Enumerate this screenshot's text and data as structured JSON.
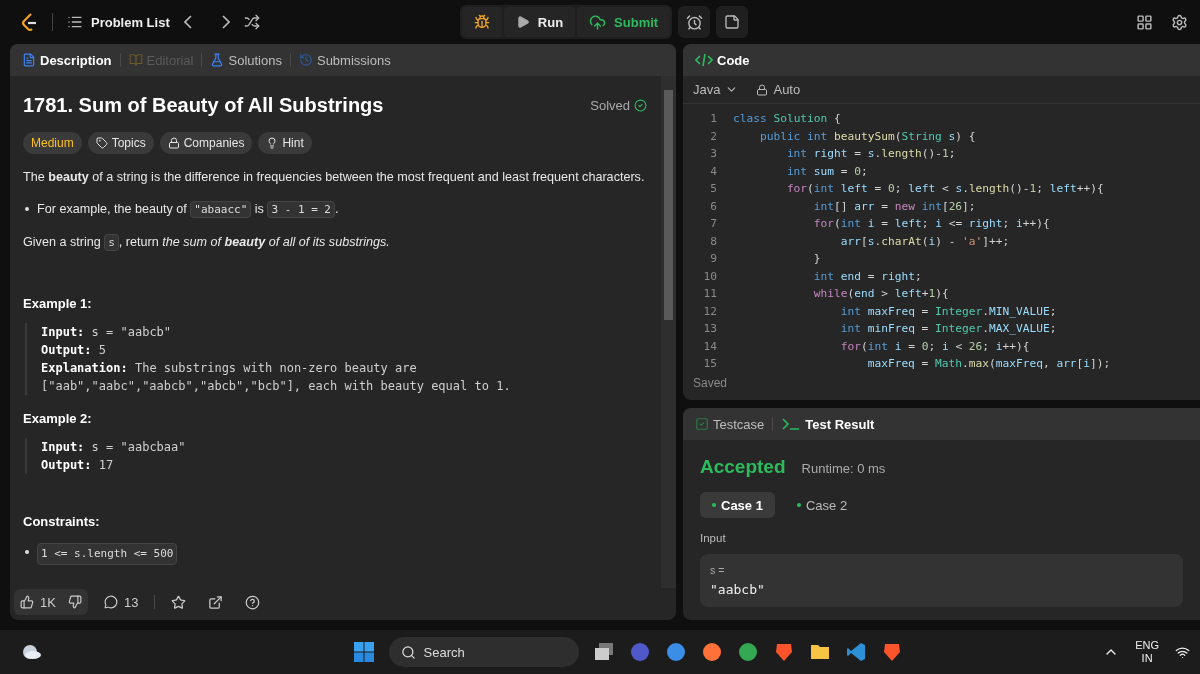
{
  "top_bar": {
    "problem_list": "Problem List",
    "run": "Run",
    "submit": "Submit"
  },
  "description_panel": {
    "tabs": [
      {
        "label": "Description",
        "selected": true,
        "disabled": false
      },
      {
        "label": "Editorial",
        "selected": false,
        "disabled": true
      },
      {
        "label": "Solutions",
        "selected": false,
        "disabled": false
      },
      {
        "label": "Submissions",
        "selected": false,
        "disabled": false
      }
    ],
    "title": "1781. Sum of Beauty of All Substrings",
    "status": "Solved",
    "tags": [
      {
        "label": "Medium",
        "kind": "difficulty"
      },
      {
        "label": "Topics",
        "kind": "topics"
      },
      {
        "label": "Companies",
        "kind": "companies"
      },
      {
        "label": "Hint",
        "kind": "hint"
      }
    ],
    "paragraphs": [
      {
        "kind": "para",
        "parts": [
          {
            "kind": "text",
            "t": "The **beauty** of a string is the difference in frequencies between the most frequent and least frequent characters."
          }
        ]
      },
      {
        "kind": "bullet",
        "parts": [
          {
            "kind": "text",
            "t": "For example, the beauty of "
          },
          {
            "kind": "code",
            "t": "\"abaacc\""
          },
          {
            "kind": "text",
            "t": " is "
          },
          {
            "kind": "code",
            "t": "3 - 1 = 2"
          },
          {
            "kind": "text",
            "t": "."
          }
        ]
      },
      {
        "kind": "para",
        "parts": [
          {
            "kind": "text",
            "t": "Given a string "
          },
          {
            "kind": "code",
            "t": "s"
          },
          {
            "kind": "text",
            "t": ", return "
          },
          {
            "kind": "em",
            "t": "the sum of **beauty** of all of its substrings."
          }
        ]
      }
    ],
    "examples": [
      {
        "heading": "Example 1:",
        "lines": [
          {
            "label": "Input:",
            "value": "s = \"aabcb\""
          },
          {
            "label": "Output:",
            "value": "5"
          },
          {
            "label": "Explanation:",
            "value": "The substrings with non-zero beauty are [\"aab\",\"aabc\",\"aabcb\",\"abcb\",\"bcb\"], each with beauty equal to 1."
          }
        ]
      },
      {
        "heading": "Example 2:",
        "lines": [
          {
            "label": "Input:",
            "value": "s = \"aabcbaa\""
          },
          {
            "label": "Output:",
            "value": "17"
          }
        ]
      }
    ],
    "constraints": {
      "heading": "Constraints:",
      "items": [
        "1 <= s.length <= 500"
      ]
    },
    "footer": {
      "likes": "1K",
      "comments": "13"
    }
  },
  "code_panel": {
    "title": "Code",
    "language": "Java",
    "mode": "Auto",
    "status": "Saved",
    "lines": [
      {
        "number": "1",
        "tokens": [
          {
            "kind": "keyword",
            "t": "class"
          },
          {
            "kind": "type",
            "t": " Solution"
          },
          {
            "kind": "plain",
            "t": " {"
          }
        ]
      },
      {
        "number": "2",
        "tokens": [
          {
            "kind": "keyword",
            "t": "    public"
          },
          {
            "kind": "keyword",
            "t": " int"
          },
          {
            "kind": "function",
            "t": " beautySum"
          },
          {
            "kind": "plain",
            "t": "("
          },
          {
            "kind": "type",
            "t": "String"
          },
          {
            "kind": "variable",
            "t": " s"
          },
          {
            "kind": "plain",
            "t": ") {"
          }
        ]
      },
      {
        "number": "3",
        "tokens": [
          {
            "kind": "keyword",
            "t": "        int"
          },
          {
            "kind": "variable",
            "t": " right"
          },
          {
            "kind": "plain",
            "t": " = "
          },
          {
            "kind": "variable",
            "t": "s"
          },
          {
            "kind": "plain",
            "t": "."
          },
          {
            "kind": "function",
            "t": "length"
          },
          {
            "kind": "plain",
            "t": "()-"
          },
          {
            "kind": "number",
            "t": "1"
          },
          {
            "kind": "plain",
            "t": ";"
          }
        ]
      },
      {
        "number": "4",
        "tokens": [
          {
            "kind": "keyword",
            "t": "        int"
          },
          {
            "kind": "variable",
            "t": " sum"
          },
          {
            "kind": "plain",
            "t": " = "
          },
          {
            "kind": "number",
            "t": "0"
          },
          {
            "kind": "plain",
            "t": ";"
          }
        ]
      },
      {
        "number": "5",
        "tokens": [
          {
            "kind": "control",
            "t": "        for"
          },
          {
            "kind": "plain",
            "t": "("
          },
          {
            "kind": "keyword",
            "t": "int"
          },
          {
            "kind": "variable",
            "t": " left"
          },
          {
            "kind": "plain",
            "t": " = "
          },
          {
            "kind": "number",
            "t": "0"
          },
          {
            "kind": "plain",
            "t": "; "
          },
          {
            "kind": "variable",
            "t": "left"
          },
          {
            "kind": "plain",
            "t": " < "
          },
          {
            "kind": "variable",
            "t": "s"
          },
          {
            "kind": "plain",
            "t": "."
          },
          {
            "kind": "function",
            "t": "length"
          },
          {
            "kind": "plain",
            "t": "()-"
          },
          {
            "kind": "number",
            "t": "1"
          },
          {
            "kind": "plain",
            "t": "; "
          },
          {
            "kind": "variable",
            "t": "left"
          },
          {
            "kind": "plain",
            "t": "++){"
          }
        ]
      },
      {
        "number": "6",
        "tokens": [
          {
            "kind": "keyword",
            "t": "            int"
          },
          {
            "kind": "plain",
            "t": "[] "
          },
          {
            "kind": "variable",
            "t": "arr"
          },
          {
            "kind": "plain",
            "t": " = "
          },
          {
            "kind": "control",
            "t": "new"
          },
          {
            "kind": "keyword",
            "t": " int"
          },
          {
            "kind": "plain",
            "t": "["
          },
          {
            "kind": "number",
            "t": "26"
          },
          {
            "kind": "plain",
            "t": "];"
          }
        ]
      },
      {
        "number": "7",
        "tokens": [
          {
            "kind": "control",
            "t": "            for"
          },
          {
            "kind": "plain",
            "t": "("
          },
          {
            "kind": "keyword",
            "t": "int"
          },
          {
            "kind": "variable",
            "t": " i"
          },
          {
            "kind": "plain",
            "t": " = "
          },
          {
            "kind": "variable",
            "t": "left"
          },
          {
            "kind": "plain",
            "t": "; "
          },
          {
            "kind": "variable",
            "t": "i"
          },
          {
            "kind": "plain",
            "t": " <= "
          },
          {
            "kind": "variable",
            "t": "right"
          },
          {
            "kind": "plain",
            "t": "; "
          },
          {
            "kind": "variable",
            "t": "i"
          },
          {
            "kind": "plain",
            "t": "++){"
          }
        ]
      },
      {
        "number": "8",
        "tokens": [
          {
            "kind": "variable",
            "t": "                arr"
          },
          {
            "kind": "plain",
            "t": "["
          },
          {
            "kind": "variable",
            "t": "s"
          },
          {
            "kind": "plain",
            "t": "."
          },
          {
            "kind": "function",
            "t": "charAt"
          },
          {
            "kind": "plain",
            "t": "("
          },
          {
            "kind": "variable",
            "t": "i"
          },
          {
            "kind": "plain",
            "t": ") - "
          },
          {
            "kind": "string",
            "t": "'a'"
          },
          {
            "kind": "plain",
            "t": "]++;"
          }
        ]
      },
      {
        "number": "9",
        "tokens": [
          {
            "kind": "plain",
            "t": "            }"
          }
        ]
      },
      {
        "number": "10",
        "tokens": [
          {
            "kind": "keyword",
            "t": "            int"
          },
          {
            "kind": "variable",
            "t": " end"
          },
          {
            "kind": "plain",
            "t": " = "
          },
          {
            "kind": "variable",
            "t": "right"
          },
          {
            "kind": "plain",
            "t": ";"
          }
        ]
      },
      {
        "number": "11",
        "tokens": [
          {
            "kind": "control",
            "t": "            while"
          },
          {
            "kind": "plain",
            "t": "("
          },
          {
            "kind": "variable",
            "t": "end"
          },
          {
            "kind": "plain",
            "t": " > "
          },
          {
            "kind": "variable",
            "t": "left"
          },
          {
            "kind": "plain",
            "t": "+"
          },
          {
            "kind": "number",
            "t": "1"
          },
          {
            "kind": "plain",
            "t": "){"
          }
        ]
      },
      {
        "number": "12",
        "tokens": [
          {
            "kind": "keyword",
            "t": "                int"
          },
          {
            "kind": "variable",
            "t": " maxFreq"
          },
          {
            "kind": "plain",
            "t": " = "
          },
          {
            "kind": "type",
            "t": "Integer"
          },
          {
            "kind": "plain",
            "t": "."
          },
          {
            "kind": "variable",
            "t": "MIN_VALUE"
          },
          {
            "kind": "plain",
            "t": ";"
          }
        ]
      },
      {
        "number": "13",
        "tokens": [
          {
            "kind": "keyword",
            "t": "                int"
          },
          {
            "kind": "variable",
            "t": " minFreq"
          },
          {
            "kind": "plain",
            "t": " = "
          },
          {
            "kind": "type",
            "t": "Integer"
          },
          {
            "kind": "plain",
            "t": "."
          },
          {
            "kind": "variable",
            "t": "MAX_VALUE"
          },
          {
            "kind": "plain",
            "t": ";"
          }
        ]
      },
      {
        "number": "14",
        "tokens": [
          {
            "kind": "control",
            "t": "                for"
          },
          {
            "kind": "plain",
            "t": "("
          },
          {
            "kind": "keyword",
            "t": "int"
          },
          {
            "kind": "variable",
            "t": " i"
          },
          {
            "kind": "plain",
            "t": " = "
          },
          {
            "kind": "number",
            "t": "0"
          },
          {
            "kind": "plain",
            "t": "; "
          },
          {
            "kind": "variable",
            "t": "i"
          },
          {
            "kind": "plain",
            "t": " < "
          },
          {
            "kind": "number",
            "t": "26"
          },
          {
            "kind": "plain",
            "t": "; "
          },
          {
            "kind": "variable",
            "t": "i"
          },
          {
            "kind": "plain",
            "t": "++){"
          }
        ]
      },
      {
        "number": "15",
        "tokens": [
          {
            "kind": "variable",
            "t": "                    maxFreq"
          },
          {
            "kind": "plain",
            "t": " = "
          },
          {
            "kind": "type",
            "t": "Math"
          },
          {
            "kind": "plain",
            "t": "."
          },
          {
            "kind": "function",
            "t": "max"
          },
          {
            "kind": "plain",
            "t": "("
          },
          {
            "kind": "variable",
            "t": "maxFreq"
          },
          {
            "kind": "plain",
            "t": ", "
          },
          {
            "kind": "variable",
            "t": "arr"
          },
          {
            "kind": "plain",
            "t": "["
          },
          {
            "kind": "variable",
            "t": "i"
          },
          {
            "kind": "plain",
            "t": "]);"
          }
        ]
      }
    ]
  },
  "result_panel": {
    "tabs": [
      {
        "label": "Testcase",
        "selected": false
      },
      {
        "label": "Test Result",
        "selected": true
      }
    ],
    "verdict": "Accepted",
    "runtime": "Runtime: 0 ms",
    "cases": [
      {
        "label": "Case 1",
        "selected": true
      },
      {
        "label": "Case 2",
        "selected": false
      }
    ],
    "input_label": "Input",
    "inputs": [
      {
        "name": "s =",
        "value": "\"aabcb\""
      }
    ]
  },
  "taskbar": {
    "search_placeholder": "Search",
    "language": "ENG",
    "region": "IN"
  }
}
